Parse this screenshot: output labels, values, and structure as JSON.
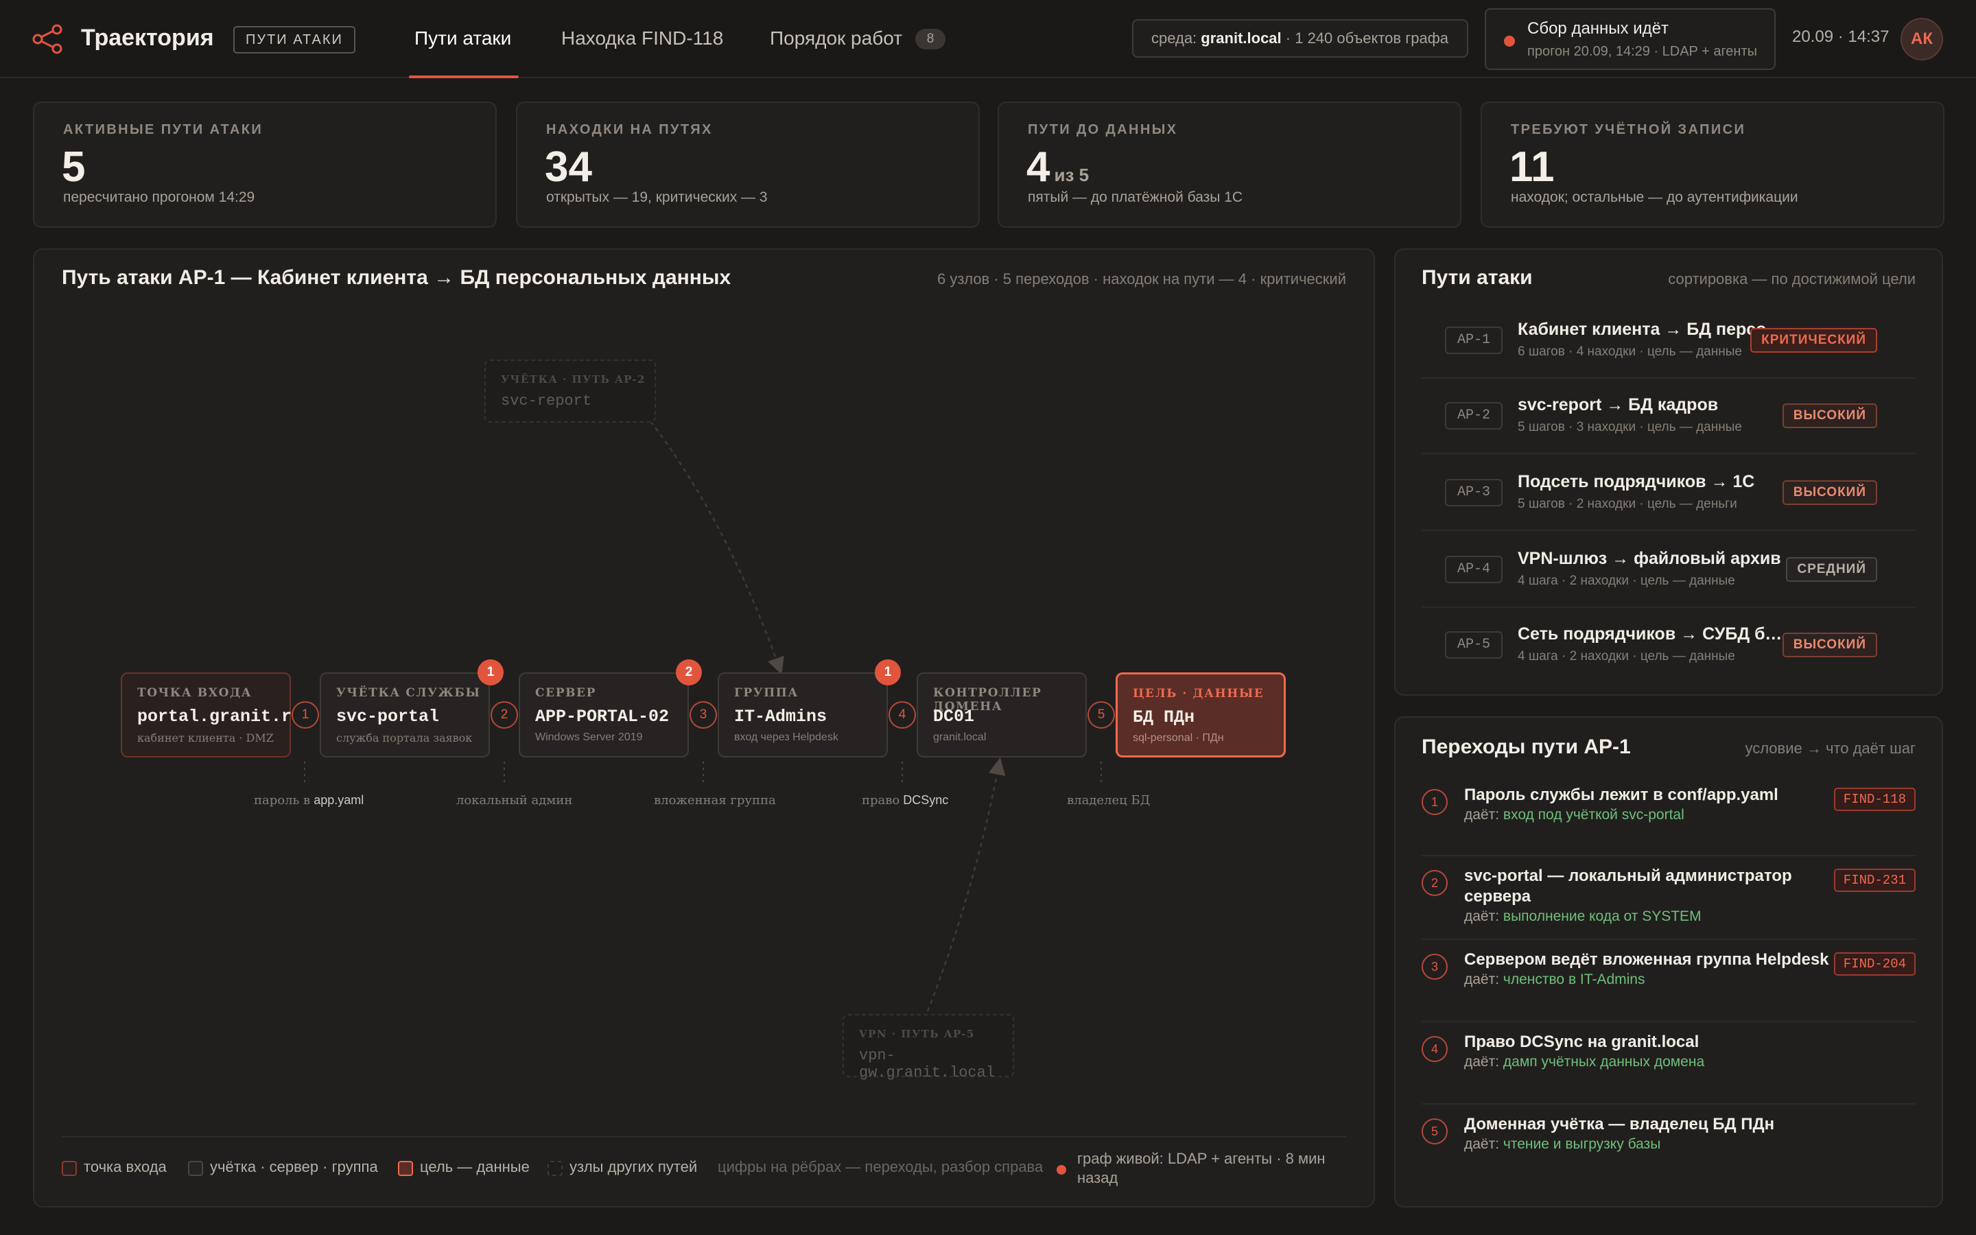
{
  "header": {
    "app_name": "Траектория",
    "app_badge": "ПУТИ АТАКИ",
    "tabs": [
      {
        "label": "Пути атаки"
      },
      {
        "label": "Находка FIND-118"
      },
      {
        "label": "Порядок работ",
        "count": "8"
      }
    ],
    "env_prefix": "среда:",
    "env_name": "granit.local",
    "env_objects": "· 1 240 объектов графа",
    "sync_title": "Сбор данных идёт",
    "sync_sub": "прогон 20.09, 14:29 · LDAP + агенты",
    "datetime": "20.09 · 14:37",
    "avatar": "АК"
  },
  "stats": [
    {
      "label": "АКТИВНЫЕ ПУТИ АТАКИ",
      "value": "5",
      "suffix": "",
      "sub": "пересчитано прогоном 14:29"
    },
    {
      "label": "НАХОДКИ НА ПУТЯХ",
      "value": "34",
      "suffix": "",
      "sub": "открытых — 19, критических — 3"
    },
    {
      "label": "ПУТИ ДО ДАННЫХ",
      "value": "4",
      "suffix": "из 5",
      "sub": "пятый — до платёжной базы 1С"
    },
    {
      "label": "ТРЕБУЮТ УЧЁТНОЙ ЗАПИСИ",
      "value": "11",
      "suffix": "",
      "sub": "находок; остальные — до аутентификации"
    }
  ],
  "graph": {
    "title": "Путь атаки AP-1 — Кабинет клиента → БД персональных данных",
    "meta": "6 узлов · 5 переходов · находок на пути — 4 · критический",
    "nodes": [
      {
        "kind": "ТОЧКА ВХОДА",
        "name": "portal.granit.ru",
        "sub": "кабинет клиента · DMZ"
      },
      {
        "kind": "УЧЁТКА СЛУЖБЫ",
        "name": "svc-portal",
        "sub": "служба портала заявок",
        "findings": "1"
      },
      {
        "kind": "СЕРВЕР",
        "name": "APP-PORTAL-02",
        "sub": "Windows Server 2019",
        "findings": "2"
      },
      {
        "kind": "ГРУППА",
        "name": "IT-Admins",
        "sub": "вход через Helpdesk",
        "findings": "1"
      },
      {
        "kind": "КОНТРОЛЛЕР ДОМЕНА",
        "name": "DC01",
        "sub": "granit.local"
      },
      {
        "kind": "ЦЕЛЬ · ДАННЫЕ",
        "name": "БД ПДн",
        "sub": "sql-personal · ПДн"
      }
    ],
    "edges": [
      "1",
      "2",
      "3",
      "4",
      "5"
    ],
    "edge_labels": [
      {
        "pre": "пароль в",
        "key": "app.yaml"
      },
      {
        "pre": "локальный админ",
        "key": ""
      },
      {
        "pre": "вложенная группа",
        "key": ""
      },
      {
        "pre": "право",
        "key": "DCSync"
      },
      {
        "pre": "владелец БД",
        "key": ""
      }
    ],
    "ghost_nodes": [
      {
        "kind": "УЧЁТКА · ПУТЬ AP-2",
        "name": "svc-report"
      },
      {
        "kind": "VPN · ПУТЬ AP-5",
        "name": "vpn-gw.granit.local"
      }
    ],
    "legend": {
      "entry": "точка входа",
      "internal": "учётка · сервер · группа",
      "target": "цель — данные",
      "other": "узлы других путей",
      "note": "цифры на рёбрах — переходы, разбор справа",
      "live_line1": "граф живой: LDAP + агенты · 8 мин",
      "live_line2": "назад"
    }
  },
  "paths_panel": {
    "title": "Пути атаки",
    "meta": "сортировка — по достижимой цели",
    "items": [
      {
        "id": "AP-1",
        "title": "Кабинет клиента → БД персональных данных",
        "meta": "6 шагов · 4 находки · цель — данные",
        "severity": "КРИТИЧЕСКИЙ",
        "level": "crit"
      },
      {
        "id": "AP-2",
        "title": "svc-report → БД кадров",
        "meta": "5 шагов · 3 находки · цель — данные",
        "severity": "ВЫСОКИЙ",
        "level": "high"
      },
      {
        "id": "AP-3",
        "title": "Подсеть подрядчиков → 1С",
        "meta": "5 шагов · 2 находки · цель — деньги",
        "severity": "ВЫСОКИЙ",
        "level": "high"
      },
      {
        "id": "AP-4",
        "title": "VPN-шлюз → файловый архив",
        "meta": "4 шага · 2 находки · цель — данные",
        "severity": "СРЕДНИЙ",
        "level": "med"
      },
      {
        "id": "AP-5",
        "title": "Сеть подрядчиков → СУБД бухгалтерии",
        "meta": "4 шага · 2 находки · цель — данные",
        "severity": "ВЫСОКИЙ",
        "level": "high"
      }
    ]
  },
  "transitions_panel": {
    "title": "Переходы пути AP-1",
    "meta": "условие → что даёт шаг",
    "gives_label": "даёт:",
    "items": [
      {
        "n": "1",
        "title": "Пароль службы лежит в conf/app.yaml",
        "gives": "вход под учёткой svc-portal",
        "finding": "FIND-118"
      },
      {
        "n": "2",
        "title": "svc-portal — локальный администратор сервера",
        "gives": "выполнение кода от SYSTEM",
        "finding": "FIND-231"
      },
      {
        "n": "3",
        "title": "Сервером ведёт вложенная группа Helpdesk",
        "gives": "членство в IT-Admins",
        "finding": "FIND-204"
      },
      {
        "n": "4",
        "title": "Право DCSync на granit.local",
        "gives": "дамп учётных данных домена",
        "finding": ""
      },
      {
        "n": "5",
        "title": "Доменная учётка — владелец БД ПДн",
        "gives": "чтение и выгрузку базы",
        "finding": ""
      }
    ]
  },
  "colors": {
    "accent": "#e2553d",
    "good": "#6fbf7a",
    "bg": "#1b1a19",
    "panel": "#211f1e"
  }
}
